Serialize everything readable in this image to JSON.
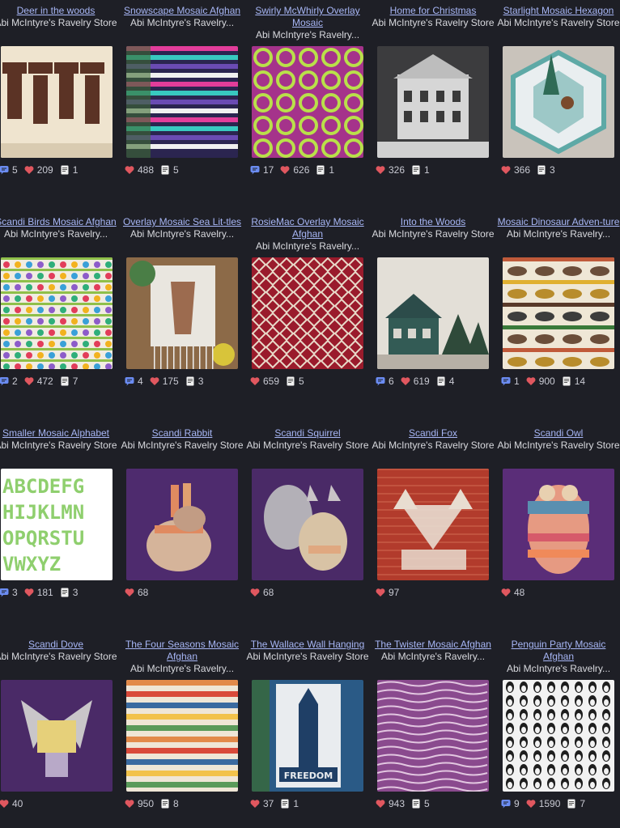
{
  "colors": {
    "background": "#1e1f26",
    "link": "#a7b6f5",
    "heart": "#e0575f",
    "chat": "#6b8cf2"
  },
  "patterns": [
    {
      "title": "Deer in the woods",
      "store": "Abi McIntyre's Ravelry Store",
      "comments": "5",
      "hearts": "209",
      "projects": "1"
    },
    {
      "title": "Snowscape Mosaic Afghan",
      "store": "Abi McIntyre's Ravelry...",
      "comments": "",
      "hearts": "488",
      "projects": "5"
    },
    {
      "title": "Swirly McWhirly Overlay Mosaic",
      "store": "Abi McIntyre's Ravelry...",
      "comments": "17",
      "hearts": "626",
      "projects": "1"
    },
    {
      "title": "Home for Christmas",
      "store": "Abi McIntyre's Ravelry Store",
      "comments": "",
      "hearts": "326",
      "projects": "1"
    },
    {
      "title": "Starlight Mosaic Hexagon",
      "store": "Abi McIntyre's Ravelry Store",
      "comments": "",
      "hearts": "366",
      "projects": "3"
    },
    {
      "title": "Scandi Birds Mosaic Afghan",
      "store": "Abi McIntyre's Ravelry...",
      "comments": "2",
      "hearts": "472",
      "projects": "7"
    },
    {
      "title": "Overlay Mosaic Sea Lit-tles",
      "store": "Abi McIntyre's Ravelry...",
      "comments": "4",
      "hearts": "175",
      "projects": "3"
    },
    {
      "title": "RosieMac Overlay Mosaic Afghan",
      "store": "Abi McIntyre's Ravelry...",
      "comments": "",
      "hearts": "659",
      "projects": "5"
    },
    {
      "title": "Into the Woods",
      "store": "Abi McIntyre's Ravelry Store",
      "comments": "6",
      "hearts": "619",
      "projects": "4"
    },
    {
      "title": "Mosaic Dinosaur Adven-ture",
      "store": "Abi McIntyre's Ravelry...",
      "comments": "1",
      "hearts": "900",
      "projects": "14"
    },
    {
      "title": "Smaller Mosaic Alphabet",
      "store": "Abi McIntyre's Ravelry Store",
      "comments": "3",
      "hearts": "181",
      "projects": "3"
    },
    {
      "title": "Scandi Rabbit",
      "store": "Abi McIntyre's Ravelry Store",
      "comments": "",
      "hearts": "68",
      "projects": ""
    },
    {
      "title": "Scandi Squirrel",
      "store": "Abi McIntyre's Ravelry Store",
      "comments": "",
      "hearts": "68",
      "projects": ""
    },
    {
      "title": "Scandi Fox",
      "store": "Abi McIntyre's Ravelry Store",
      "comments": "",
      "hearts": "97",
      "projects": ""
    },
    {
      "title": "Scandi Owl",
      "store": "Abi McIntyre's Ravelry Store",
      "comments": "",
      "hearts": "48",
      "projects": ""
    },
    {
      "title": "Scandi Dove",
      "store": "Abi McIntyre's Ravelry Store",
      "comments": "",
      "hearts": "40",
      "projects": ""
    },
    {
      "title": "The Four Seasons Mosaic Afghan",
      "store": "Abi McIntyre's Ravelry...",
      "comments": "",
      "hearts": "950",
      "projects": "8"
    },
    {
      "title": "The Wallace Wall Hanging",
      "store": "Abi McIntyre's Ravelry Store",
      "comments": "",
      "hearts": "37",
      "projects": "1"
    },
    {
      "title": "The Twister Mosaic Afghan",
      "store": "Abi McIntyre's Ravelry...",
      "comments": "",
      "hearts": "943",
      "projects": "5"
    },
    {
      "title": "Penguin Party Mosaic Afghan",
      "store": "Abi McIntyre's Ravelry...",
      "comments": "9",
      "hearts": "1590",
      "projects": "7"
    }
  ],
  "alphabet_image_text": [
    "ABCDEFG",
    "HIJKLMN",
    "OPQRSTU",
    "VWXYZ"
  ],
  "wallace_image_text": "FREEDOM"
}
